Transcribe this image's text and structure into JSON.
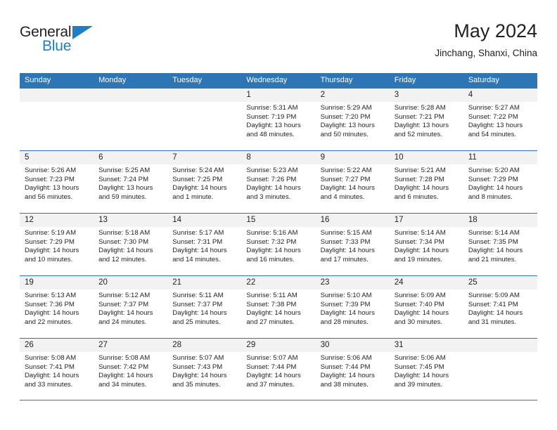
{
  "logo": {
    "word_top": "General",
    "word_bottom": "Blue",
    "accent_color": "#1f7fc4"
  },
  "header": {
    "title": "May 2024",
    "subtitle": "Jinchang, Shanxi, China"
  },
  "theme": {
    "header_band": "#2e75b6",
    "date_band": "#f2f2f2",
    "text": "#231f20"
  },
  "weekdays": [
    "Sunday",
    "Monday",
    "Tuesday",
    "Wednesday",
    "Thursday",
    "Friday",
    "Saturday"
  ],
  "weeks": [
    [
      {
        "day": "",
        "sunrise": "",
        "sunset": "",
        "daylight": ""
      },
      {
        "day": "",
        "sunrise": "",
        "sunset": "",
        "daylight": ""
      },
      {
        "day": "",
        "sunrise": "",
        "sunset": "",
        "daylight": ""
      },
      {
        "day": "1",
        "sunrise": "Sunrise: 5:31 AM",
        "sunset": "Sunset: 7:19 PM",
        "daylight": "Daylight: 13 hours and 48 minutes."
      },
      {
        "day": "2",
        "sunrise": "Sunrise: 5:29 AM",
        "sunset": "Sunset: 7:20 PM",
        "daylight": "Daylight: 13 hours and 50 minutes."
      },
      {
        "day": "3",
        "sunrise": "Sunrise: 5:28 AM",
        "sunset": "Sunset: 7:21 PM",
        "daylight": "Daylight: 13 hours and 52 minutes."
      },
      {
        "day": "4",
        "sunrise": "Sunrise: 5:27 AM",
        "sunset": "Sunset: 7:22 PM",
        "daylight": "Daylight: 13 hours and 54 minutes."
      }
    ],
    [
      {
        "day": "5",
        "sunrise": "Sunrise: 5:26 AM",
        "sunset": "Sunset: 7:23 PM",
        "daylight": "Daylight: 13 hours and 56 minutes."
      },
      {
        "day": "6",
        "sunrise": "Sunrise: 5:25 AM",
        "sunset": "Sunset: 7:24 PM",
        "daylight": "Daylight: 13 hours and 59 minutes."
      },
      {
        "day": "7",
        "sunrise": "Sunrise: 5:24 AM",
        "sunset": "Sunset: 7:25 PM",
        "daylight": "Daylight: 14 hours and 1 minute."
      },
      {
        "day": "8",
        "sunrise": "Sunrise: 5:23 AM",
        "sunset": "Sunset: 7:26 PM",
        "daylight": "Daylight: 14 hours and 3 minutes."
      },
      {
        "day": "9",
        "sunrise": "Sunrise: 5:22 AM",
        "sunset": "Sunset: 7:27 PM",
        "daylight": "Daylight: 14 hours and 4 minutes."
      },
      {
        "day": "10",
        "sunrise": "Sunrise: 5:21 AM",
        "sunset": "Sunset: 7:28 PM",
        "daylight": "Daylight: 14 hours and 6 minutes."
      },
      {
        "day": "11",
        "sunrise": "Sunrise: 5:20 AM",
        "sunset": "Sunset: 7:29 PM",
        "daylight": "Daylight: 14 hours and 8 minutes."
      }
    ],
    [
      {
        "day": "12",
        "sunrise": "Sunrise: 5:19 AM",
        "sunset": "Sunset: 7:29 PM",
        "daylight": "Daylight: 14 hours and 10 minutes."
      },
      {
        "day": "13",
        "sunrise": "Sunrise: 5:18 AM",
        "sunset": "Sunset: 7:30 PM",
        "daylight": "Daylight: 14 hours and 12 minutes."
      },
      {
        "day": "14",
        "sunrise": "Sunrise: 5:17 AM",
        "sunset": "Sunset: 7:31 PM",
        "daylight": "Daylight: 14 hours and 14 minutes."
      },
      {
        "day": "15",
        "sunrise": "Sunrise: 5:16 AM",
        "sunset": "Sunset: 7:32 PM",
        "daylight": "Daylight: 14 hours and 16 minutes."
      },
      {
        "day": "16",
        "sunrise": "Sunrise: 5:15 AM",
        "sunset": "Sunset: 7:33 PM",
        "daylight": "Daylight: 14 hours and 17 minutes."
      },
      {
        "day": "17",
        "sunrise": "Sunrise: 5:14 AM",
        "sunset": "Sunset: 7:34 PM",
        "daylight": "Daylight: 14 hours and 19 minutes."
      },
      {
        "day": "18",
        "sunrise": "Sunrise: 5:14 AM",
        "sunset": "Sunset: 7:35 PM",
        "daylight": "Daylight: 14 hours and 21 minutes."
      }
    ],
    [
      {
        "day": "19",
        "sunrise": "Sunrise: 5:13 AM",
        "sunset": "Sunset: 7:36 PM",
        "daylight": "Daylight: 14 hours and 22 minutes."
      },
      {
        "day": "20",
        "sunrise": "Sunrise: 5:12 AM",
        "sunset": "Sunset: 7:37 PM",
        "daylight": "Daylight: 14 hours and 24 minutes."
      },
      {
        "day": "21",
        "sunrise": "Sunrise: 5:11 AM",
        "sunset": "Sunset: 7:37 PM",
        "daylight": "Daylight: 14 hours and 25 minutes."
      },
      {
        "day": "22",
        "sunrise": "Sunrise: 5:11 AM",
        "sunset": "Sunset: 7:38 PM",
        "daylight": "Daylight: 14 hours and 27 minutes."
      },
      {
        "day": "23",
        "sunrise": "Sunrise: 5:10 AM",
        "sunset": "Sunset: 7:39 PM",
        "daylight": "Daylight: 14 hours and 28 minutes."
      },
      {
        "day": "24",
        "sunrise": "Sunrise: 5:09 AM",
        "sunset": "Sunset: 7:40 PM",
        "daylight": "Daylight: 14 hours and 30 minutes."
      },
      {
        "day": "25",
        "sunrise": "Sunrise: 5:09 AM",
        "sunset": "Sunset: 7:41 PM",
        "daylight": "Daylight: 14 hours and 31 minutes."
      }
    ],
    [
      {
        "day": "26",
        "sunrise": "Sunrise: 5:08 AM",
        "sunset": "Sunset: 7:41 PM",
        "daylight": "Daylight: 14 hours and 33 minutes."
      },
      {
        "day": "27",
        "sunrise": "Sunrise: 5:08 AM",
        "sunset": "Sunset: 7:42 PM",
        "daylight": "Daylight: 14 hours and 34 minutes."
      },
      {
        "day": "28",
        "sunrise": "Sunrise: 5:07 AM",
        "sunset": "Sunset: 7:43 PM",
        "daylight": "Daylight: 14 hours and 35 minutes."
      },
      {
        "day": "29",
        "sunrise": "Sunrise: 5:07 AM",
        "sunset": "Sunset: 7:44 PM",
        "daylight": "Daylight: 14 hours and 37 minutes."
      },
      {
        "day": "30",
        "sunrise": "Sunrise: 5:06 AM",
        "sunset": "Sunset: 7:44 PM",
        "daylight": "Daylight: 14 hours and 38 minutes."
      },
      {
        "day": "31",
        "sunrise": "Sunrise: 5:06 AM",
        "sunset": "Sunset: 7:45 PM",
        "daylight": "Daylight: 14 hours and 39 minutes."
      },
      {
        "day": "",
        "sunrise": "",
        "sunset": "",
        "daylight": ""
      }
    ]
  ]
}
